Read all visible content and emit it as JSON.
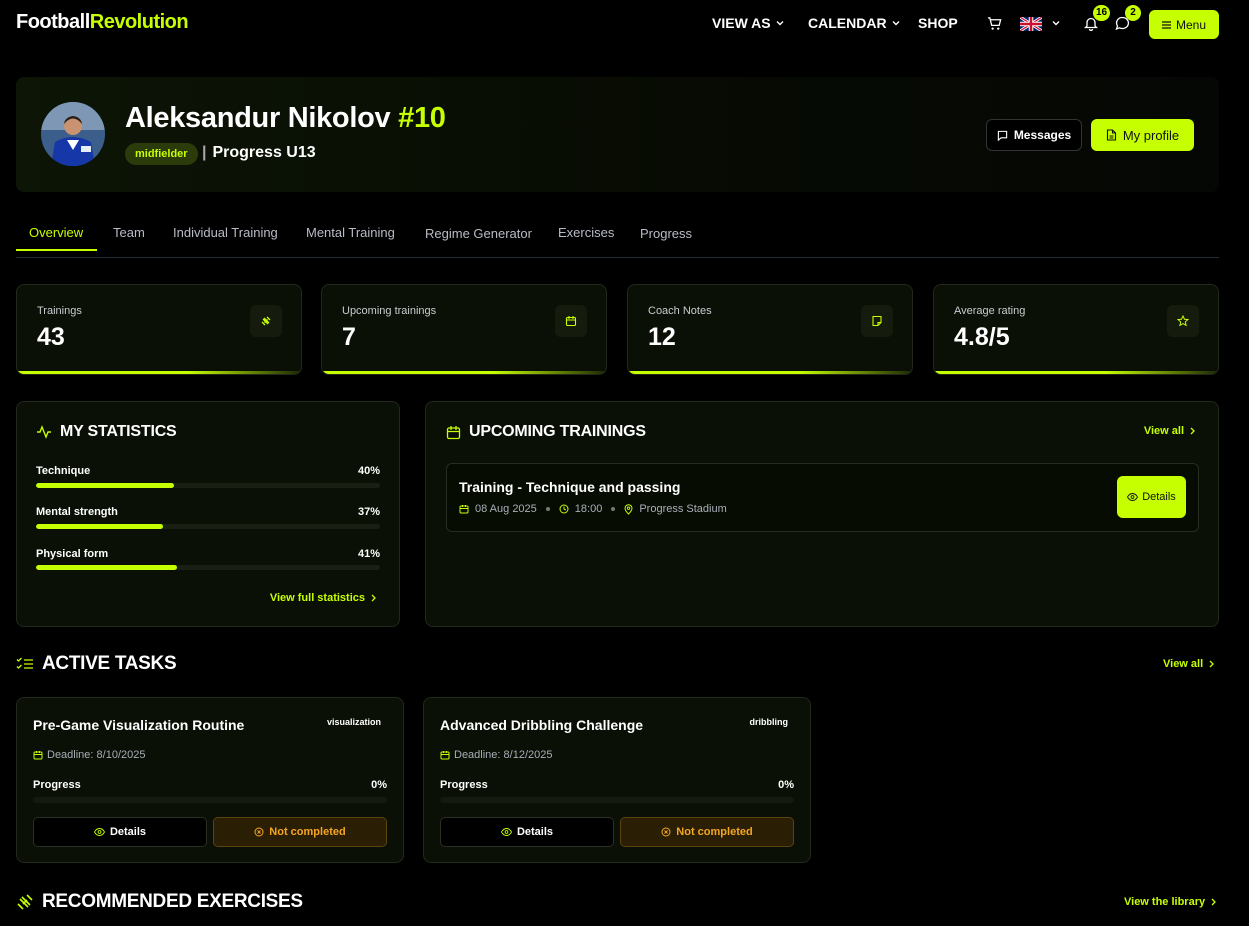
{
  "nav": {
    "logo_a": "Football",
    "logo_b": "Revolution",
    "view_as": "VIEW AS",
    "calendar": "CALENDAR",
    "shop": "SHOP",
    "notifications_count": "16",
    "messages_count": "2",
    "menu_label": "Menu"
  },
  "profile": {
    "name": "Aleksandur Nikolov",
    "number": "#10",
    "position": "midfielder",
    "separator": "|",
    "team": "Progress U13",
    "messages_label": "Messages",
    "my_profile_label": "My profile"
  },
  "tabs": [
    "Overview",
    "Team",
    "Individual Training",
    "Mental Training",
    "Regime Generator",
    "Exercises",
    "Progress"
  ],
  "stats": [
    {
      "label": "Trainings",
      "value": "43",
      "icon": "dumbbell-icon"
    },
    {
      "label": "Upcoming trainings",
      "value": "7",
      "icon": "calendar-icon"
    },
    {
      "label": "Coach Notes",
      "value": "12",
      "icon": "note-icon"
    },
    {
      "label": "Average rating",
      "value": "4.8/5",
      "icon": "star-icon"
    }
  ],
  "my_statistics": {
    "title": "MY STATISTICS",
    "items": [
      {
        "label": "Technique",
        "value": "40%",
        "fraction": 0.4
      },
      {
        "label": "Mental strength",
        "value": "37%",
        "fraction": 0.37
      },
      {
        "label": "Physical form",
        "value": "41%",
        "fraction": 0.41
      }
    ],
    "link": "View full statistics"
  },
  "upcoming": {
    "title": "UPCOMING TRAININGS",
    "view_all": "View all",
    "item": {
      "title": "Training - Technique and passing",
      "date": "08 Aug 2025",
      "time": "18:00",
      "location": "Progress Stadium",
      "details": "Details"
    }
  },
  "tasks": {
    "title": "ACTIVE TASKS",
    "view_all": "View all",
    "items": [
      {
        "title": "Pre-Game Visualization Routine",
        "tag": "visualization",
        "deadline": "Deadline: 8/10/2025",
        "progress_label": "Progress",
        "progress": "0%",
        "details": "Details",
        "status": "Not completed"
      },
      {
        "title": "Advanced Dribbling Challenge",
        "tag": "dribbling",
        "deadline": "Deadline: 8/12/2025",
        "progress_label": "Progress",
        "progress": "0%",
        "details": "Details",
        "status": "Not completed"
      }
    ]
  },
  "recommended": {
    "title": "RECOMMENDED EXERCISES",
    "link": "View the library"
  },
  "colors": {
    "accent": "#c6ff00",
    "background": "#000000",
    "card": "#0a1005",
    "warning": "#f5a623"
  }
}
